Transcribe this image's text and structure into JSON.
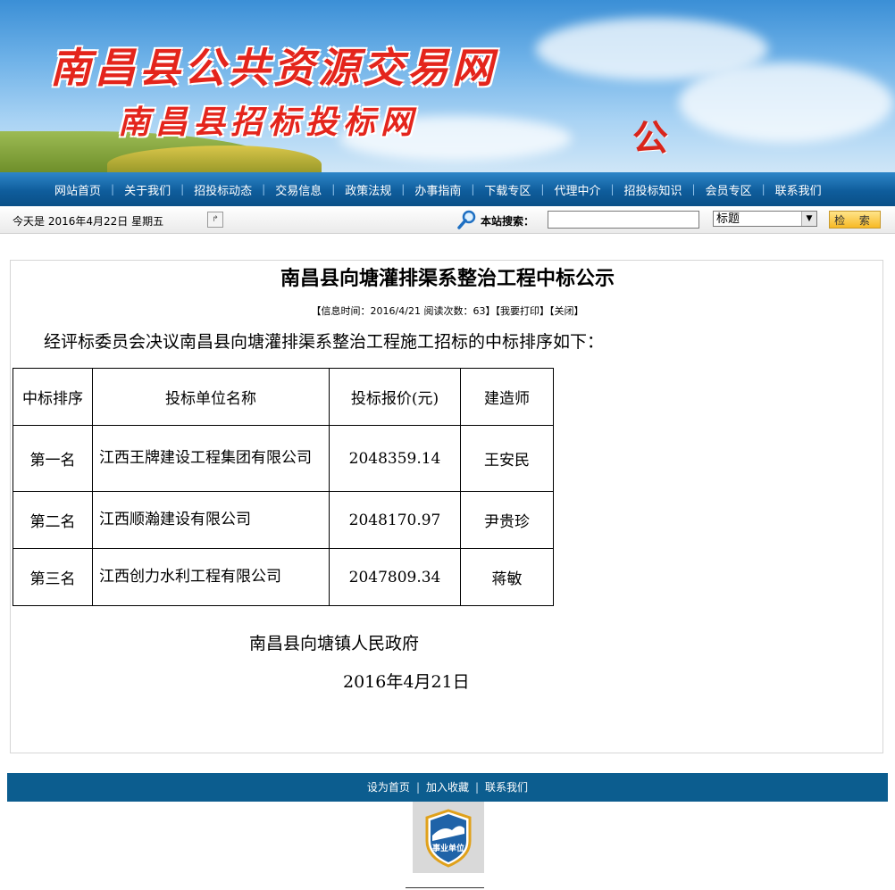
{
  "banner": {
    "title": "南昌县公共资源交易网",
    "subtitle": "南昌县招标投标网",
    "seal": "公"
  },
  "nav": {
    "items": [
      "网站首页",
      "关于我们",
      "招投标动态",
      "交易信息",
      "政策法规",
      "办事指南",
      "下载专区",
      "代理中介",
      "招投标知识",
      "会员专区",
      "联系我们"
    ],
    "separator": "|"
  },
  "infobar": {
    "date": "今天是  2016年4月22日  星期五",
    "search_label": "本站搜索：",
    "search_value": "",
    "select_value": "标题",
    "search_button": "检 索"
  },
  "article": {
    "title": "南昌县向塘灌排渠系整治工程中标公示",
    "meta": {
      "info_time": "【信息时间：2016/4/21  阅读次数：63】",
      "print": "【我要打印】",
      "close": "【关闭】"
    },
    "intro": "经评标委员会决议南昌县向塘灌排渠系整治工程施工招标的中标排序如下：",
    "table": {
      "headers": [
        "中标排序",
        "投标单位名称",
        "投标报价(元)",
        "建造师"
      ],
      "rows": [
        [
          "第一名",
          "江西王牌建设工程集团有限公司",
          "2048359.14",
          "王安民"
        ],
        [
          "第二名",
          "江西顺瀚建设有限公司",
          "2048170.97",
          "尹贵珍"
        ],
        [
          "第三名",
          "江西创力水利工程有限公司",
          "2047809.34",
          "蒋敏"
        ]
      ]
    },
    "signature": "南昌县向塘镇人民政府",
    "sign_date": "2016年4月21日"
  },
  "footer": {
    "links": [
      "设为首页",
      "加入收藏",
      "联系我们"
    ],
    "separator": "|",
    "badge_text": "事业单位"
  },
  "colors": {
    "nav_bg": "#0f5d9c",
    "footer_bg": "#0c5d8f",
    "title_red": "#e4251c",
    "button_yellow": "#f7b925"
  }
}
